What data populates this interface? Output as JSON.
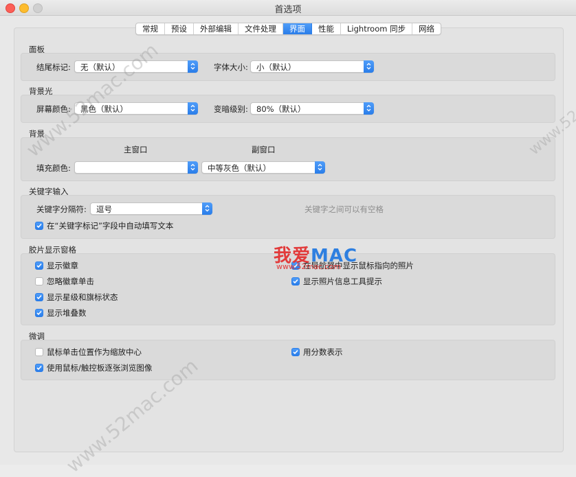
{
  "window": {
    "title": "首选项"
  },
  "tabs": [
    {
      "label": "常规",
      "active": false
    },
    {
      "label": "预设",
      "active": false
    },
    {
      "label": "外部编辑",
      "active": false
    },
    {
      "label": "文件处理",
      "active": false
    },
    {
      "label": "界面",
      "active": true
    },
    {
      "label": "性能",
      "active": false
    },
    {
      "label": "Lightroom 同步",
      "active": false
    },
    {
      "label": "网络",
      "active": false
    }
  ],
  "panel": {
    "title": "面板",
    "end_marks_label": "结尾标记:",
    "end_marks_value": "无（默认）",
    "font_size_label": "字体大小:",
    "font_size_value": "小（默认）"
  },
  "lights_out": {
    "title": "背景光",
    "screen_color_label": "屏幕颜色:",
    "screen_color_value": "黑色（默认）",
    "dim_level_label": "变暗级别:",
    "dim_level_value": "80%（默认）"
  },
  "background": {
    "title": "背景",
    "main_window_label": "主窗口",
    "secondary_window_label": "副窗口",
    "fill_color_label": "填充颜色:",
    "main_fill_value": "",
    "secondary_fill_value": "中等灰色（默认）"
  },
  "keyword_entry": {
    "title": "关键字输入",
    "separator_label": "关键字分隔符:",
    "separator_value": "逗号",
    "hint": "关键字之间可以有空格",
    "autofill_label": "在“关键字标记”字段中自动填写文本",
    "autofill_checked": true
  },
  "filmstrip": {
    "title": "胶片显示窗格",
    "show_badges": {
      "label": "显示徽章",
      "checked": true
    },
    "ignore_badge_clicks": {
      "label": "忽略徽章单击",
      "checked": false
    },
    "show_ratings_picks": {
      "label": "显示星级和旗标状态",
      "checked": true
    },
    "show_stack_counts": {
      "label": "显示堆叠数",
      "checked": true
    },
    "show_photos_navigator": {
      "label": "在导航器中显示鼠标指向的照片",
      "checked": true
    },
    "show_info_tooltips": {
      "label": "显示照片信息工具提示",
      "checked": true
    }
  },
  "tweaks": {
    "title": "微调",
    "zoom_clicked_point": {
      "label": "鼠标单击位置作为缩放中心",
      "checked": false
    },
    "use_trackpad": {
      "label": "使用鼠标/触控板逐张浏览图像",
      "checked": true
    },
    "use_fractions": {
      "label": "用分数表示",
      "checked": true
    }
  },
  "watermark": {
    "site": "www.52mac.com",
    "logo_cn": "我爱",
    "logo_en": "MAC",
    "logo_url": "www.52mac.com"
  },
  "colors": {
    "accent": "#2a7de9",
    "window_bg": "#e8e8e8",
    "box_bg": "#dadada"
  }
}
